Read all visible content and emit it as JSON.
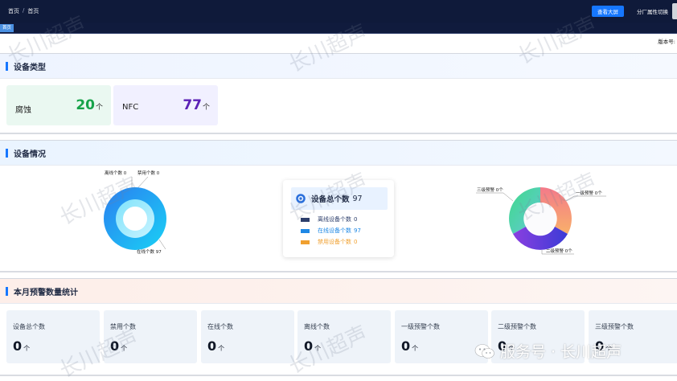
{
  "header": {
    "breadcrumb": [
      "首页",
      "/",
      "首页"
    ],
    "bigscreen_button": "查看大屏",
    "factory_switch": "分厂属性切换"
  },
  "tabs": {
    "home": "首页"
  },
  "version_label": "版本号:",
  "device_types": {
    "title": "设备类型",
    "items": [
      {
        "name": "腐蚀",
        "count": "20",
        "unit": "个",
        "color": "#17a34a"
      },
      {
        "name": "NFC",
        "count": "77",
        "unit": "个",
        "color": "#5b21b6"
      }
    ]
  },
  "device_status": {
    "title": "设备情况",
    "left_chart_labels": [
      "离线个数 0",
      "禁用个数 0",
      "在线个数 97"
    ],
    "legend": {
      "total_label": "设备总个数",
      "total": "97",
      "items": [
        {
          "label": "离线设备个数",
          "value": "0",
          "color": "#2c3e6b"
        },
        {
          "label": "在线设备个数",
          "value": "97",
          "color": "#1e88e5"
        },
        {
          "label": "禁用设备个数",
          "value": "0",
          "color": "#f0a030"
        }
      ]
    },
    "right_chart_labels": [
      "三级预警 0个",
      "一级预警 0个",
      "二级预警 0个"
    ]
  },
  "monthly_alarms": {
    "title": "本月预警数量统计",
    "stats": [
      {
        "label": "设备总个数",
        "value": "0",
        "unit": "个"
      },
      {
        "label": "禁用个数",
        "value": "0",
        "unit": "个"
      },
      {
        "label": "在线个数",
        "value": "0",
        "unit": "个"
      },
      {
        "label": "离线个数",
        "value": "0",
        "unit": "个"
      },
      {
        "label": "一级预警个数",
        "value": "0",
        "unit": "个"
      },
      {
        "label": "二级预警个数",
        "value": "0",
        "unit": "个"
      },
      {
        "label": "三级预警个数",
        "value": "0",
        "unit": "个"
      }
    ]
  },
  "watermark": {
    "text": "长川超声",
    "footer": "服务号 · 长川超声"
  },
  "colors": {
    "accent": "#1677ff",
    "topbar": "#0f1a3a"
  }
}
